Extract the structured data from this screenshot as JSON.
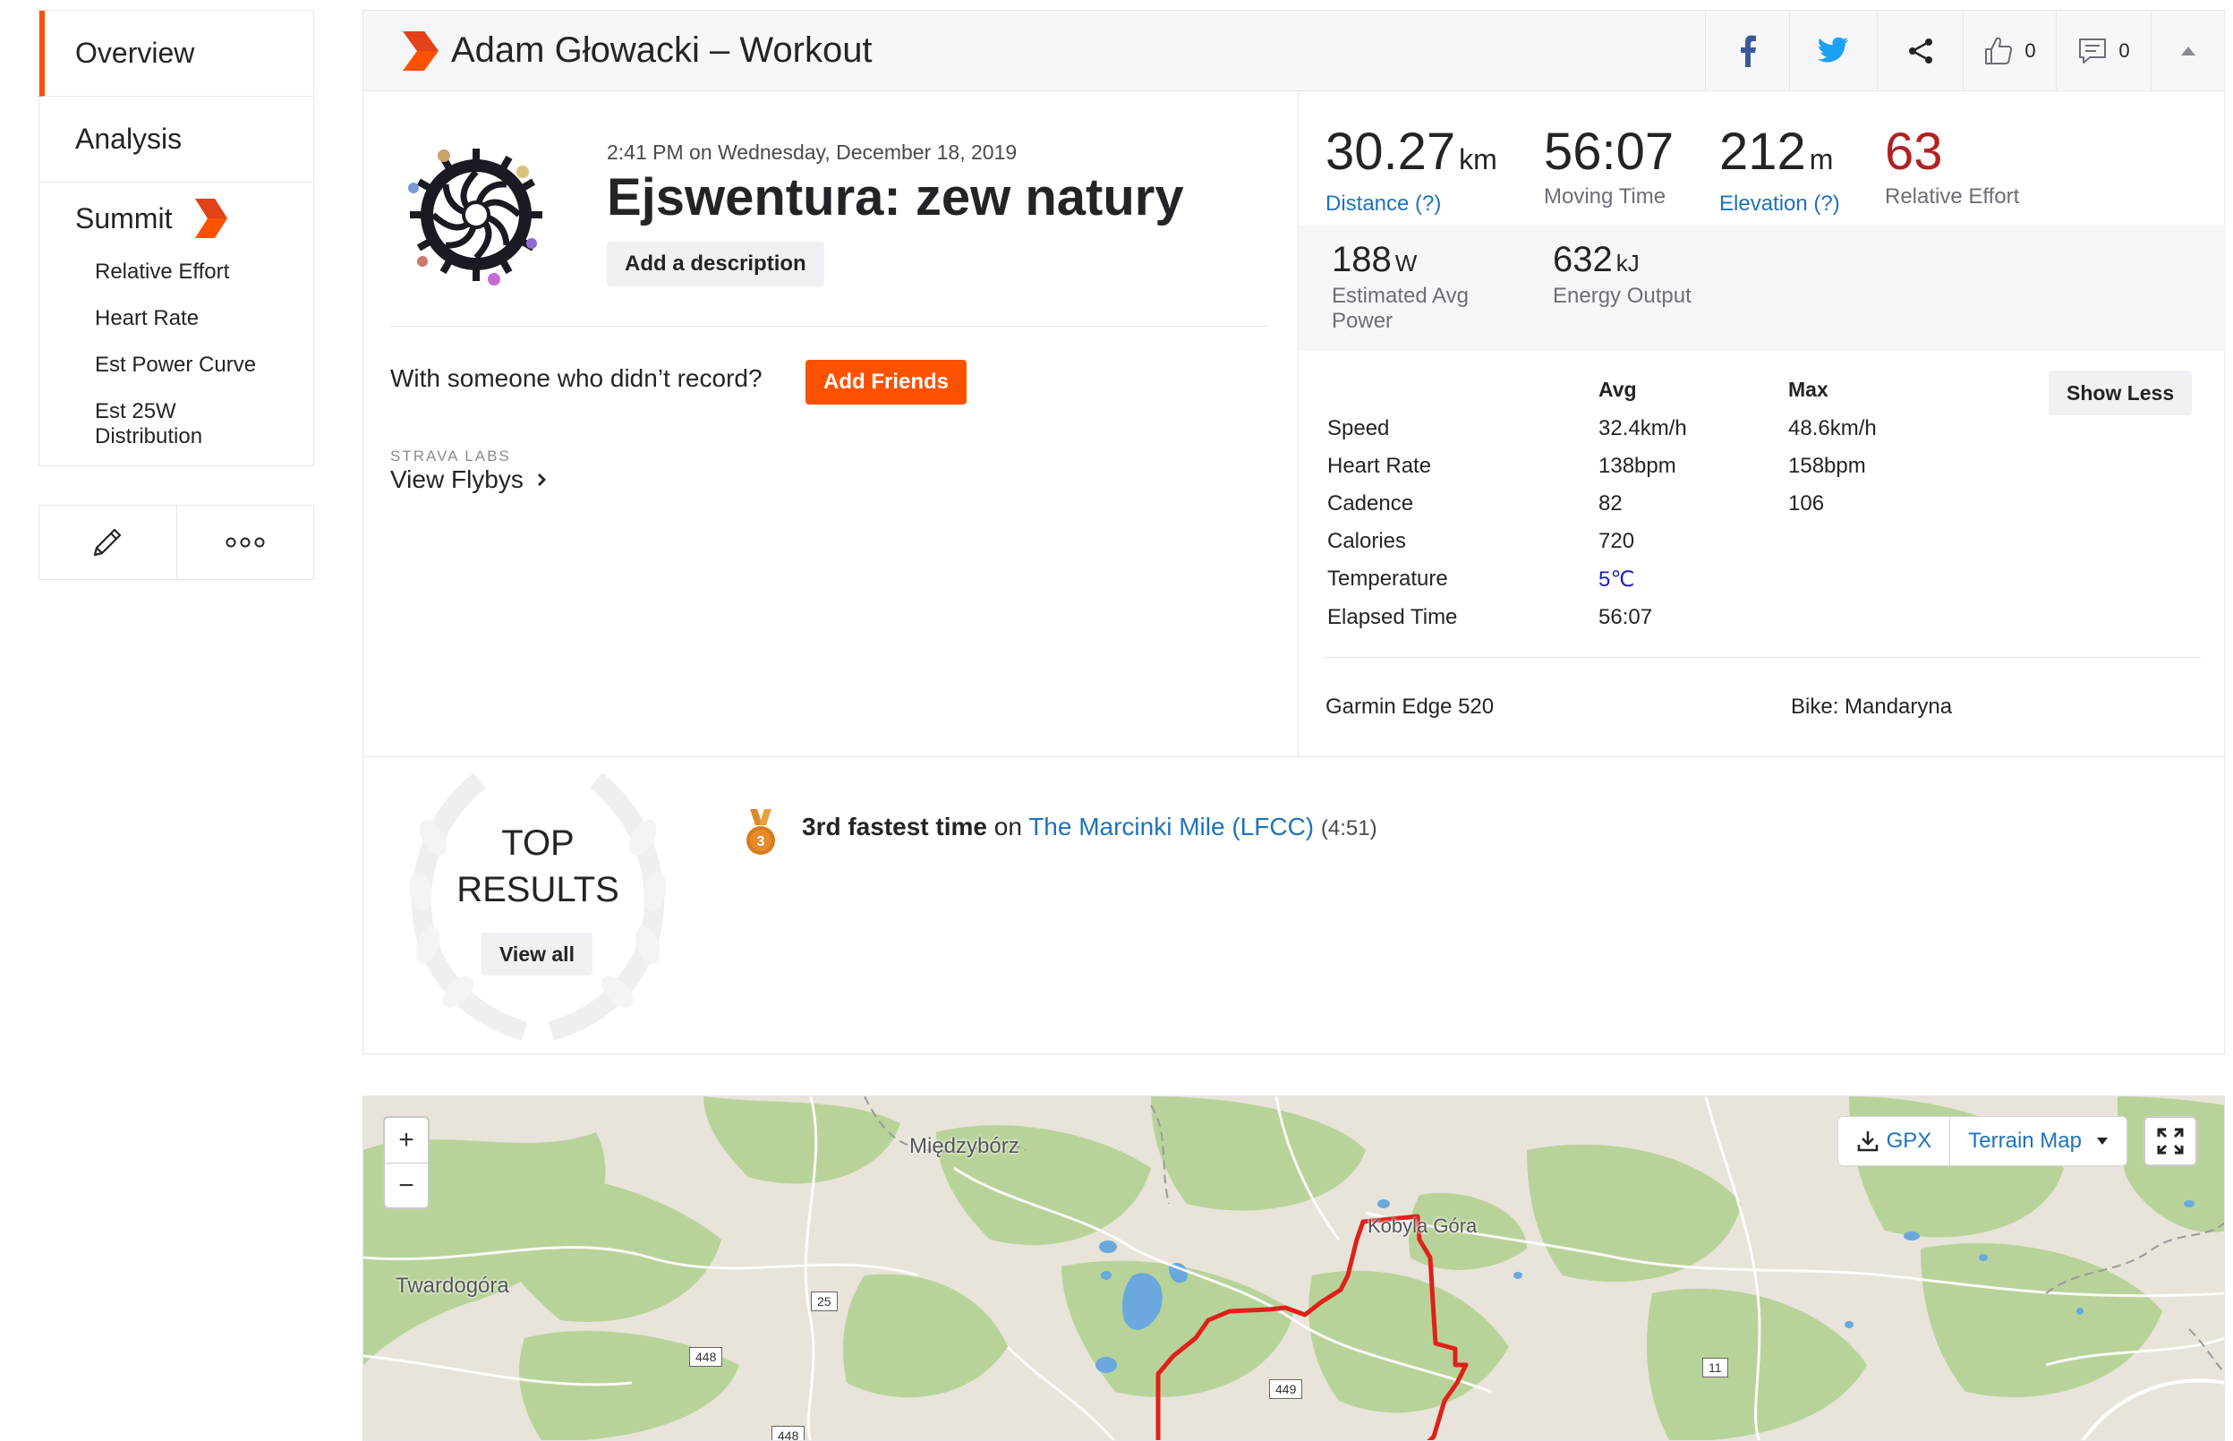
{
  "sidebar": {
    "items": [
      {
        "label": "Overview"
      },
      {
        "label": "Analysis"
      }
    ],
    "summit": {
      "label": "Summit"
    },
    "sub_items": [
      {
        "label": "Relative Effort"
      },
      {
        "label": "Heart Rate"
      },
      {
        "label": "Est Power Curve"
      },
      {
        "label": "Est 25W Distribution"
      }
    ],
    "actions": [
      "pencil-icon",
      "more-icon"
    ]
  },
  "header": {
    "title": "Adam Głowacki – Workout",
    "kudos_count": "0",
    "comment_count": "0"
  },
  "activity": {
    "date": "2:41 PM on Wednesday, December 18, 2019",
    "name": "Ejswentura: zew natury",
    "add_description": "Add a description",
    "someone_text": "With someone who didn’t record?",
    "add_friends": "Add Friends",
    "labs_label": "STRAVA LABS",
    "flybys_label": "View Flybys"
  },
  "stats": {
    "distance": {
      "value": "30.27",
      "unit": "km",
      "label": "Distance (?)"
    },
    "moving_time": {
      "value": "56:07",
      "label": "Moving Time"
    },
    "elevation": {
      "value": "212",
      "unit": "m",
      "label": "Elevation (?)"
    },
    "relative_effort": {
      "value": "63",
      "label": "Relative Effort"
    },
    "power": {
      "value": "188",
      "unit": "W",
      "label": "Estimated Avg Power"
    },
    "energy": {
      "value": "632",
      "unit": "kJ",
      "label": "Energy Output"
    }
  },
  "more_stats": {
    "avg_header": "Avg",
    "max_header": "Max",
    "show_less": "Show Less",
    "rows": [
      {
        "label": "Speed",
        "avg": "32.4km/h",
        "max": "48.6km/h"
      },
      {
        "label": "Heart Rate",
        "avg": "138bpm",
        "max": "158bpm"
      },
      {
        "label": "Cadence",
        "avg": "82",
        "max": "106"
      },
      {
        "label": "Calories",
        "avg": "720",
        "max": ""
      },
      {
        "label": "Temperature",
        "avg": "5℃",
        "max": ""
      },
      {
        "label": "Elapsed Time",
        "avg": "56:07",
        "max": ""
      }
    ],
    "device": "Garmin Edge 520",
    "bike": "Bike: Mandaryna"
  },
  "results": {
    "title_line1": "TOP",
    "title_line2": "RESULTS",
    "view_all": "View all",
    "medal_rank": "3",
    "achievement": "3rd fastest time",
    "on_text": "on",
    "segment": "The Marcinki Mile (LFCC)",
    "time": "(4:51)"
  },
  "map": {
    "zoom_in": "+",
    "zoom_out": "−",
    "gpx_label": "GPX",
    "terrain_label": "Terrain Map",
    "places": [
      "Międzybórz",
      "Twardogóra",
      "Kobyla Góra"
    ],
    "roads": [
      "25",
      "448",
      "449",
      "11",
      "448"
    ]
  },
  "colors": {
    "brand_orange": "#fc5200",
    "link_blue": "#1e73be",
    "effort_red": "#b22222",
    "route_red": "#e0201b"
  }
}
